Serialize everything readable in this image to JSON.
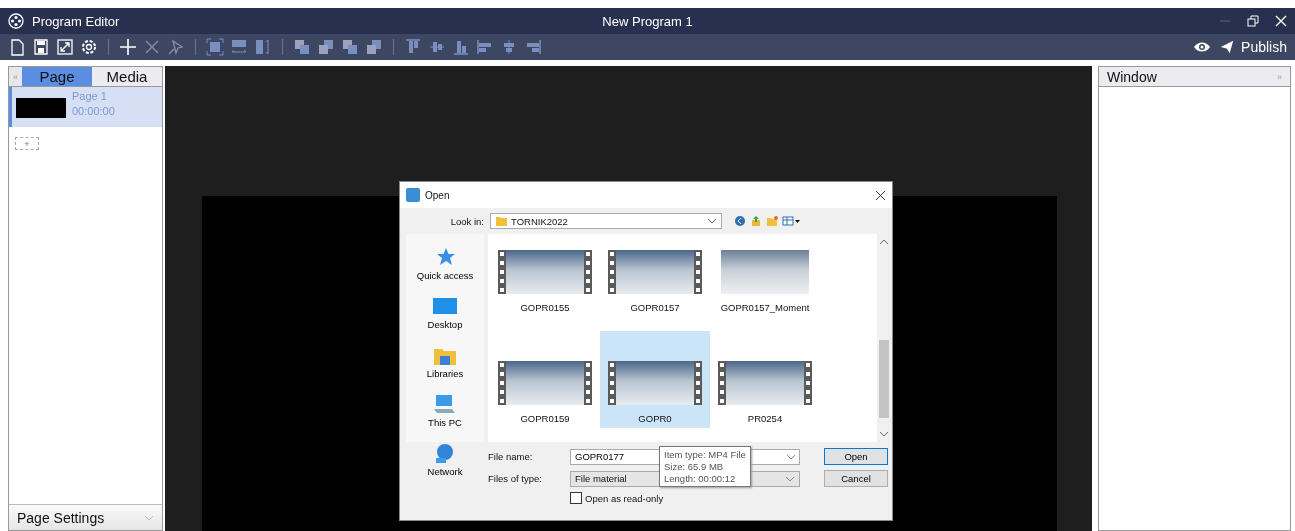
{
  "window": {
    "app_title": "Program Editor",
    "document_title": "New Program 1"
  },
  "toolbar": {
    "publish": "Publish"
  },
  "left_panel": {
    "collapse": "«",
    "tabs": [
      {
        "label": "Page",
        "selected": true
      },
      {
        "label": "Media",
        "selected": false
      }
    ],
    "pages": [
      {
        "name": "Page 1",
        "duration": "00:00:00",
        "selected": true
      }
    ],
    "add_page": "+",
    "footer": "Page Settings"
  },
  "right_panel": {
    "title": "Window",
    "expand": "»"
  },
  "dialog": {
    "title": "Open",
    "look_in_label": "Look in:",
    "look_in_value": "TORNIK2022",
    "places": [
      {
        "label": "Quick access",
        "kind": "star"
      },
      {
        "label": "Desktop",
        "kind": "desktop"
      },
      {
        "label": "Libraries",
        "kind": "folder"
      },
      {
        "label": "This PC",
        "kind": "computer"
      },
      {
        "label": "Network",
        "kind": "network"
      }
    ],
    "files": [
      {
        "name": "GOPR0155",
        "kind": "video",
        "selected": false
      },
      {
        "name": "GOPR0157",
        "kind": "video",
        "selected": false
      },
      {
        "name": "GOPR0157_Moment",
        "kind": "image",
        "selected": false
      },
      {
        "name": "GOPR0159",
        "kind": "video",
        "selected": false
      },
      {
        "name": "GOPR0",
        "kind": "video",
        "selected": true
      },
      {
        "name": "PR0254",
        "kind": "video",
        "selected": false
      }
    ],
    "tooltip": [
      "Item type: MP4 File",
      "Size: 65.9 MB",
      "Length: 00:00:12"
    ],
    "file_name_label": "File name:",
    "file_name": "GOPR0177",
    "file_type_label": "Files of type:",
    "file_type": "File material",
    "read_only": {
      "label": "Open as read-only",
      "checked": false
    },
    "buttons": [
      "Open",
      "Cancel"
    ]
  }
}
